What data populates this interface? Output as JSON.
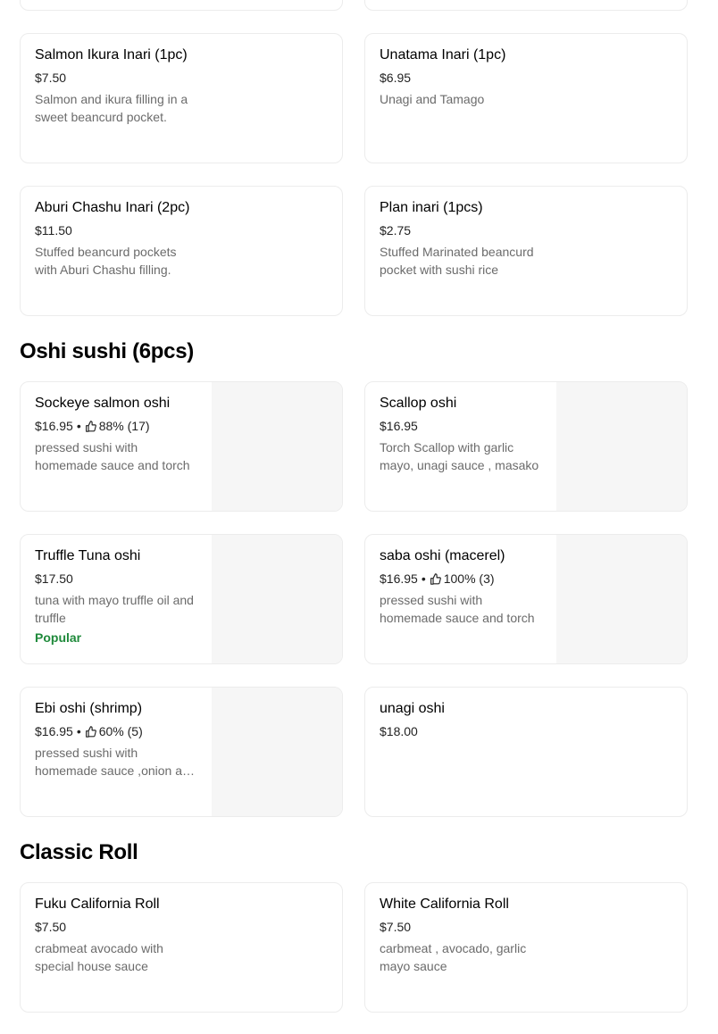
{
  "sections": [
    {
      "title": "",
      "items": [
        {
          "name": "Salmon Ikura Inari (1pc)",
          "price": "$7.50",
          "desc": "Salmon and ikura filling in a sweet beancurd pocket."
        },
        {
          "name": "Unatama Inari (1pc)",
          "price": "$6.95",
          "desc": "Unagi and Tamago"
        },
        {
          "name": "Aburi Chashu Inari (2pc)",
          "price": "$11.50",
          "desc": "Stuffed beancurd pockets with Aburi Chashu filling."
        },
        {
          "name": "Plan inari (1pcs)",
          "price": "$2.75",
          "desc": "Stuffed Marinated beancurd pocket with sushi rice"
        }
      ]
    },
    {
      "title": "Oshi sushi (6pcs)",
      "items": [
        {
          "name": "Sockeye salmon oshi",
          "price": "$16.95",
          "rating": "88% (17)",
          "desc": "pressed sushi with homemade sauce and torch"
        },
        {
          "name": "Scallop oshi",
          "price": "$16.95",
          "desc": "Torch Scallop with garlic mayo, unagi sauce , masako"
        },
        {
          "name": "Truffle Tuna oshi",
          "price": "$17.50",
          "desc": "tuna with mayo truffle oil and truffle",
          "badge": "Popular"
        },
        {
          "name": "saba oshi (macerel)",
          "price": "$16.95",
          "rating": "100% (3)",
          "desc": "pressed sushi with homemade sauce and torch"
        },
        {
          "name": "Ebi oshi (shrimp)",
          "price": "$16.95",
          "rating": "60% (5)",
          "desc": "pressed sushi with homemade sauce ,onion and torch"
        },
        {
          "name": "unagi oshi",
          "price": "$18.00",
          "desc": ""
        }
      ]
    },
    {
      "title": "Classic Roll",
      "items": [
        {
          "name": "Fuku California Roll",
          "price": "$7.50",
          "desc": "crabmeat avocado with special house sauce"
        },
        {
          "name": "White California Roll",
          "price": "$7.50",
          "desc": "carbmeat , avocado, garlic mayo sauce"
        }
      ]
    }
  ],
  "colors": {
    "popular": "#1f8a3b",
    "price": "#222222",
    "desc": "#6b6b6b",
    "image_placeholder": "#f6f6f6"
  },
  "icons": {
    "rating": "thumbs-up-icon"
  }
}
